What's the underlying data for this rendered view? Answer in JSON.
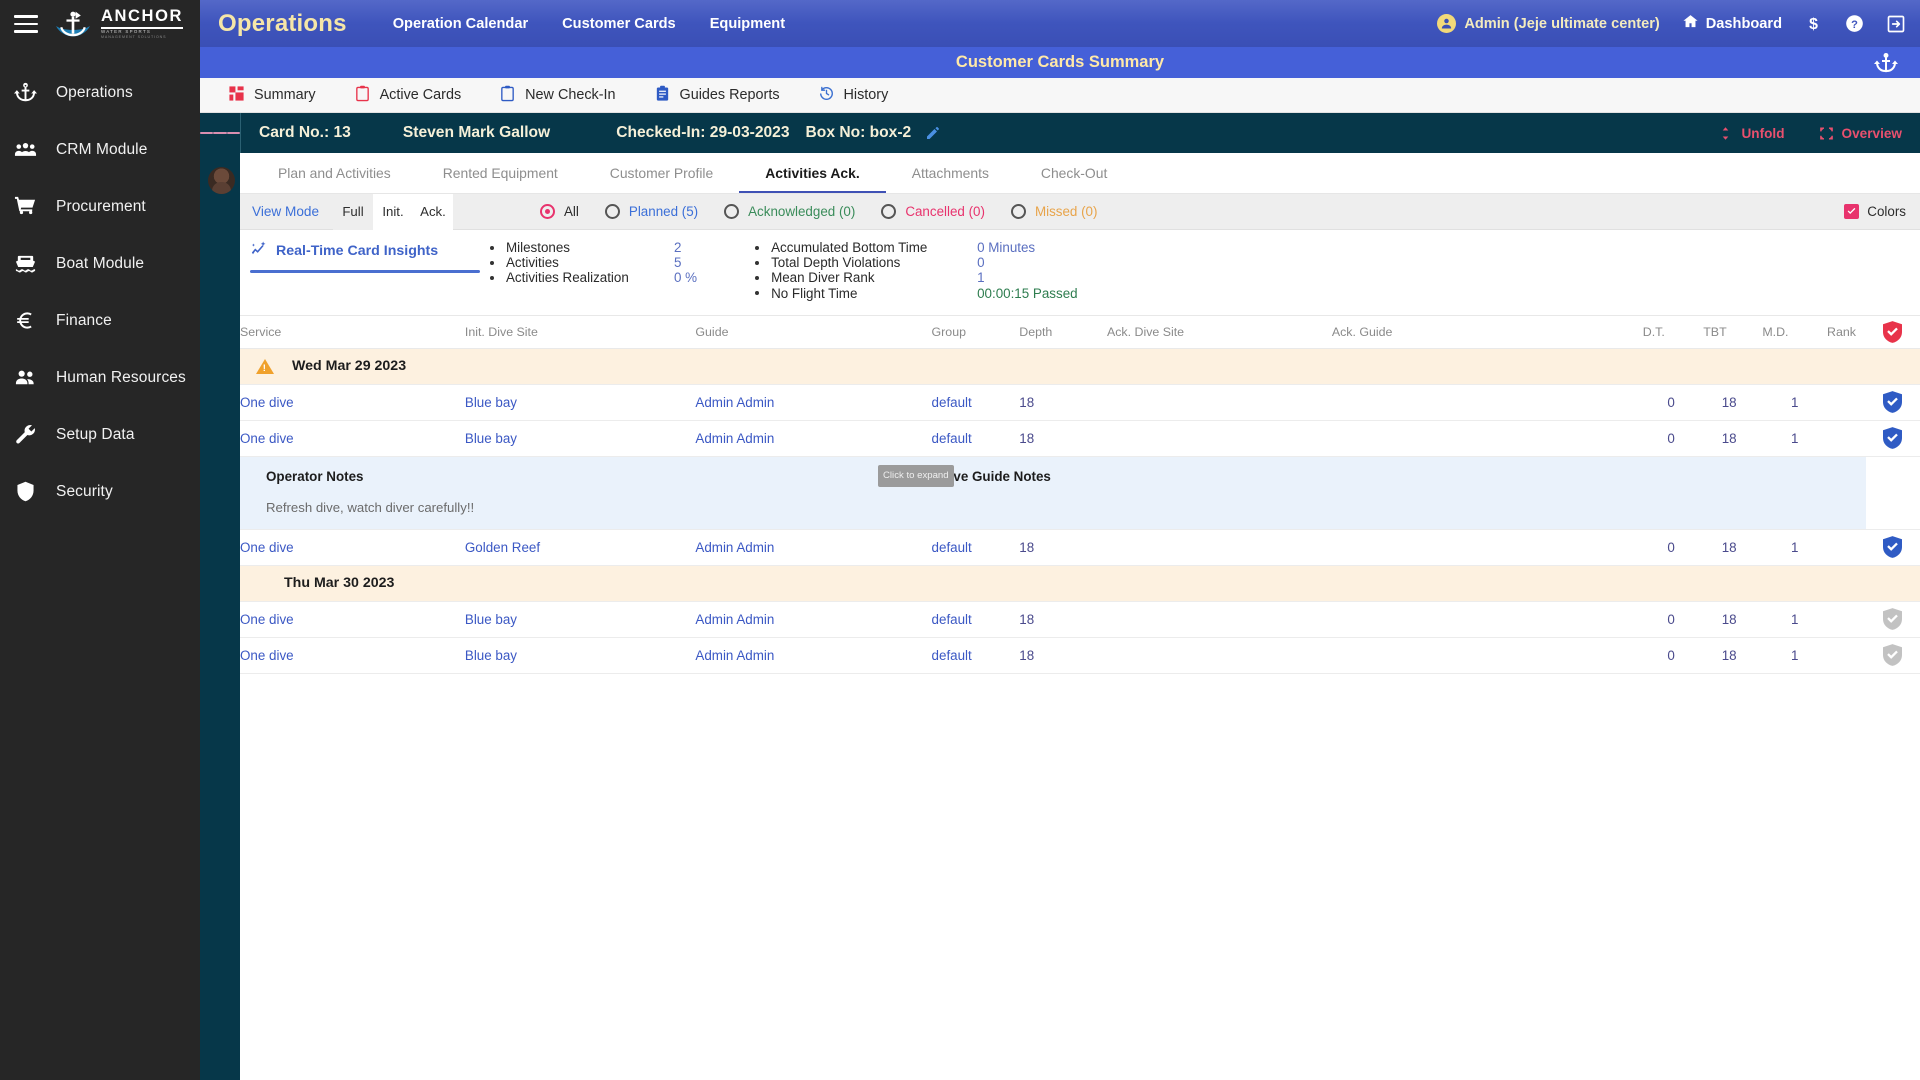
{
  "sidebar": {
    "brand": {
      "name": "ANCHOR",
      "tagline": "WATER SPORTS",
      "sub": "MANAGEMENT SOLUTIONS"
    },
    "items": [
      {
        "label": "Operations",
        "icon": "anchor-icon"
      },
      {
        "label": "CRM Module",
        "icon": "people-group-icon"
      },
      {
        "label": "Procurement",
        "icon": "shopping-cart-icon"
      },
      {
        "label": "Boat Module",
        "icon": "boat-icon"
      },
      {
        "label": "Finance",
        "icon": "euro-icon"
      },
      {
        "label": "Human Resources",
        "icon": "people-icon"
      },
      {
        "label": "Setup Data",
        "icon": "wrench-icon"
      },
      {
        "label": "Security",
        "icon": "shield-icon"
      }
    ]
  },
  "topbar": {
    "title": "Operations",
    "links": [
      "Operation Calendar",
      "Customer Cards",
      "Equipment"
    ],
    "user": "Admin (Jeje ultimate center)",
    "dashboard": "Dashboard",
    "icons": [
      "user-avatar-icon",
      "home-icon",
      "dollar-icon",
      "help-icon",
      "logout-icon"
    ]
  },
  "subbar": {
    "title": "Customer Cards Summary",
    "icon": "anchor-icon"
  },
  "module_tabs": [
    {
      "label": "Summary",
      "icon": "dashboard-grid-icon"
    },
    {
      "label": "Active Cards",
      "icon": "clipboard-icon"
    },
    {
      "label": "New Check-In",
      "icon": "clipboard-blank-icon"
    },
    {
      "label": "Guides Reports",
      "icon": "clipboard-list-icon"
    },
    {
      "label": "History",
      "icon": "history-clock-icon"
    }
  ],
  "card_header": {
    "card_no": "Card No.: 13",
    "customer": "Steven Mark Gallow",
    "checked_in": "Checked-In: 29-03-2023",
    "box_no": "Box No: box-2",
    "edit_icon": "pencil-icon",
    "unfold": "Unfold",
    "overview": "Overview"
  },
  "inner_tabs": [
    {
      "label": "Plan and Activities",
      "active": false
    },
    {
      "label": "Rented Equipment",
      "active": false
    },
    {
      "label": "Customer Profile",
      "active": false
    },
    {
      "label": "Activities Ack.",
      "active": true
    },
    {
      "label": "Attachments",
      "active": false
    },
    {
      "label": "Check-Out",
      "active": false
    }
  ],
  "filterbar": {
    "view_mode_label": "View Mode",
    "modes": [
      {
        "label": "Full",
        "selected": false
      },
      {
        "label": "Init.",
        "selected": true
      },
      {
        "label": "Ack.",
        "selected": false
      }
    ],
    "radios": [
      {
        "label": "All",
        "selected": true,
        "color": "#2b2b2b"
      },
      {
        "label": "Planned (5)",
        "selected": false,
        "color": "#3b6fd8"
      },
      {
        "label": "Acknowledged (0)",
        "selected": false,
        "color": "#3a8c5a"
      },
      {
        "label": "Cancelled (0)",
        "selected": false,
        "color": "#e8336d"
      },
      {
        "label": "Missed (0)",
        "selected": false,
        "color": "#e8a44a"
      }
    ],
    "colors_label": "Colors",
    "colors_checked": true
  },
  "insights": {
    "title": "Real-Time Card Insights",
    "icon": "trend-line-icon",
    "group1": [
      {
        "key": "Milestones",
        "value": "2"
      },
      {
        "key": "Activities",
        "value": "5"
      },
      {
        "key": "Activities Realization",
        "value": "0 %"
      }
    ],
    "group2": [
      {
        "key": "Accumulated Bottom Time",
        "value": "0 Minutes",
        "style": "blue"
      },
      {
        "key": "Total Depth Violations",
        "value": "0",
        "style": "blue"
      },
      {
        "key": "Mean Diver Rank",
        "value": "1",
        "style": "blue"
      },
      {
        "key": "No Flight Time",
        "value": "00:00:15 Passed",
        "style": "green"
      }
    ]
  },
  "table": {
    "columns": [
      "Service",
      "Init. Dive Site",
      "Guide",
      "Group",
      "Depth",
      "Ack. Dive Site",
      "Ack. Guide",
      "D.T.",
      "TBT",
      "M.D.",
      "Rank"
    ],
    "header_check_icon": "shield-check-icon",
    "rows": [
      {
        "type": "date",
        "label": "Wed Mar 29 2023",
        "warning": true
      },
      {
        "type": "data",
        "service": "One dive",
        "init_site": "Blue bay",
        "guide": "Admin Admin",
        "group": "default",
        "depth": "18",
        "ack_site": "",
        "ack_guide": "",
        "dt": "0",
        "tbt": "18",
        "md": "1",
        "rank": "",
        "ack_state": "checked"
      },
      {
        "type": "data",
        "service": "One dive",
        "init_site": "Blue bay",
        "guide": "Admin Admin",
        "group": "default",
        "depth": "18",
        "ack_site": "",
        "ack_guide": "",
        "dt": "0",
        "tbt": "18",
        "md": "1",
        "rank": "",
        "ack_state": "checked"
      },
      {
        "type": "notes",
        "operator_notes_title": "Operator Notes",
        "operator_notes_body": "Refresh dive, watch diver carefully!!",
        "dive_guide_notes_title": "Dive Guide Notes",
        "tooltip": "Click to expand"
      },
      {
        "type": "data",
        "service": "One dive",
        "init_site": "Golden Reef",
        "guide": "Admin Admin",
        "group": "default",
        "depth": "18",
        "ack_site": "",
        "ack_guide": "",
        "dt": "0",
        "tbt": "18",
        "md": "1",
        "rank": "",
        "ack_state": "checked"
      },
      {
        "type": "date",
        "label": "Thu Mar 30 2023",
        "warning": false
      },
      {
        "type": "data",
        "service": "One dive",
        "init_site": "Blue bay",
        "guide": "Admin Admin",
        "group": "default",
        "depth": "18",
        "ack_site": "",
        "ack_guide": "",
        "dt": "0",
        "tbt": "18",
        "md": "1",
        "rank": "",
        "ack_state": "disabled"
      },
      {
        "type": "data",
        "service": "One dive",
        "init_site": "Blue bay",
        "guide": "Admin Admin",
        "group": "default",
        "depth": "18",
        "ack_site": "",
        "ack_guide": "",
        "dt": "0",
        "tbt": "18",
        "md": "1",
        "rank": "",
        "ack_state": "disabled"
      }
    ]
  },
  "colors": {
    "sidebar_bg": "#262626",
    "topbar_blue": "#3f55bd",
    "subbar_blue": "#4560d8",
    "cardbar_teal": "#063749",
    "accent_gold": "#f5e6a8",
    "accent_pink": "#e8336d",
    "link_blue": "#3b58c4",
    "date_row_bg": "#fdf1e0",
    "notes_bg": "#eaf2fb"
  }
}
